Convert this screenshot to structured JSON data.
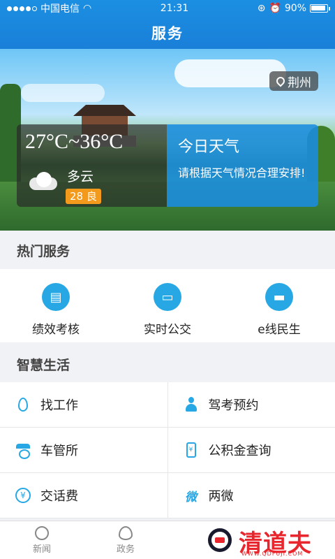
{
  "status_bar": {
    "carrier": "中国电信",
    "time": "21:31",
    "battery": "90%"
  },
  "header": {
    "title": "服务"
  },
  "banner": {
    "location": "荆州",
    "temperature": "27°C~36°C",
    "condition": "多云",
    "aqi": "28 良",
    "today_title": "今日天气",
    "today_text": "请根据天气情况合理安排!"
  },
  "hot_services": {
    "title": "热门服务",
    "items": [
      {
        "label": "绩效考核",
        "icon": "document-icon"
      },
      {
        "label": "实时公交",
        "icon": "bus-icon"
      },
      {
        "label": "e线民生",
        "icon": "chat-icon"
      }
    ]
  },
  "smart_life": {
    "title": "智慧生活",
    "items": [
      {
        "label": "找工作",
        "icon": "water-drop-icon"
      },
      {
        "label": "驾考预约",
        "icon": "driver-icon"
      },
      {
        "label": "车管所",
        "icon": "police-cap-icon"
      },
      {
        "label": "公积金查询",
        "icon": "phone-yen-icon"
      },
      {
        "label": "交话费",
        "icon": "yen-circle-icon"
      },
      {
        "label": "两微",
        "icon": "weibo-icon"
      }
    ]
  },
  "tabbar": {
    "tabs": [
      {
        "label": "新闻"
      },
      {
        "label": "政务"
      }
    ]
  },
  "watermark": {
    "text": "清道夫",
    "sub": "WWW.QDFUJI.COM"
  }
}
